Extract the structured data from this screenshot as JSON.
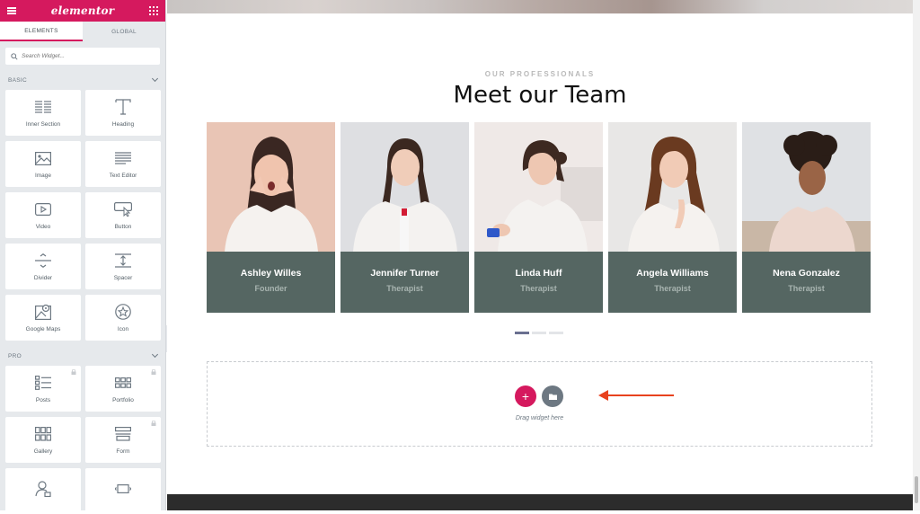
{
  "editor": {
    "brand": "elementor",
    "tabs": [
      {
        "label": "ELEMENTS"
      },
      {
        "label": "GLOBAL"
      }
    ],
    "search_placeholder": "Search Widget...",
    "sections": {
      "basic": {
        "label": "BASIC",
        "widgets": [
          {
            "label": "Inner Section",
            "icon": "inner-section-icon"
          },
          {
            "label": "Heading",
            "icon": "heading-icon"
          },
          {
            "label": "Image",
            "icon": "image-icon"
          },
          {
            "label": "Text Editor",
            "icon": "text-editor-icon"
          },
          {
            "label": "Video",
            "icon": "video-icon"
          },
          {
            "label": "Button",
            "icon": "button-icon"
          },
          {
            "label": "Divider",
            "icon": "divider-icon"
          },
          {
            "label": "Spacer",
            "icon": "spacer-icon"
          },
          {
            "label": "Google Maps",
            "icon": "google-maps-icon"
          },
          {
            "label": "Icon",
            "icon": "star-icon"
          }
        ]
      },
      "pro": {
        "label": "PRO",
        "widgets": [
          {
            "label": "Posts",
            "icon": "posts-icon"
          },
          {
            "label": "Portfolio",
            "icon": "portfolio-icon"
          },
          {
            "label": "Gallery",
            "icon": "gallery-icon"
          },
          {
            "label": "Form",
            "icon": "form-icon"
          }
        ]
      }
    }
  },
  "page": {
    "subtitle": "OUR PROFESSIONALS",
    "title": "Meet our Team",
    "team": [
      {
        "name": "Ashley Willes",
        "role": "Founder"
      },
      {
        "name": "Jennifer Turner",
        "role": "Therapist"
      },
      {
        "name": "Linda Huff",
        "role": "Therapist"
      },
      {
        "name": "Angela Williams",
        "role": "Therapist"
      },
      {
        "name": "Nena Gonzalez",
        "role": "Therapist"
      }
    ],
    "carousel_active_index": 0,
    "dropzone_text": "Drag widget here",
    "add_symbol": "+"
  },
  "colors": {
    "accent": "#d5195e",
    "card_info_bg": "#556662",
    "arrow": "#e8421e"
  }
}
